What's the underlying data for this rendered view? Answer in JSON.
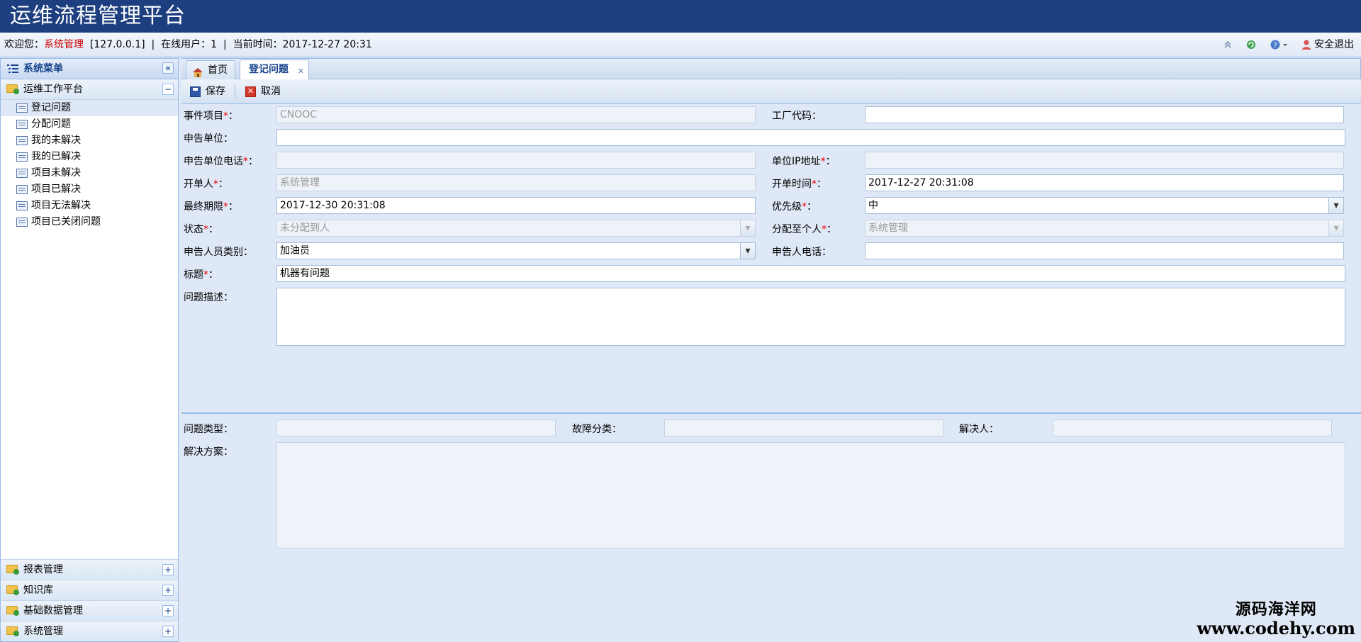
{
  "app": {
    "title": "运维流程管理平台"
  },
  "status": {
    "welcome_label": "欢迎您：",
    "user_name": "系统管理",
    "ip": "[127.0.0.1]",
    "online_label": "在线用户：1",
    "time_label": "当前时间：2017-12-27 20:31",
    "logout_label": "安全退出"
  },
  "sidebar": {
    "header": "系统菜单",
    "group_main": "运维工作平台",
    "items": [
      "登记问题",
      "分配问题",
      "我的未解决",
      "我的已解决",
      "项目未解决",
      "项目已解决",
      "项目无法解决",
      "项目已关闭问题"
    ],
    "bottom_groups": [
      "报表管理",
      "知识库",
      "基础数据管理",
      "系统管理"
    ]
  },
  "tabs": {
    "home": "首页",
    "active": "登记问题"
  },
  "toolbar": {
    "save": "保存",
    "cancel": "取消"
  },
  "form": {
    "event_project": {
      "label": "事件项目",
      "value": "CNOOC"
    },
    "factory_code": {
      "label": "工厂代码：",
      "value": ""
    },
    "report_unit": {
      "label": "申告单位：",
      "value": ""
    },
    "report_unit_phone": {
      "label": "申告单位电话",
      "value": ""
    },
    "unit_ip": {
      "label": "单位IP地址",
      "value": ""
    },
    "creator": {
      "label": "开单人",
      "value": "系统管理"
    },
    "create_time": {
      "label": "开单时间",
      "value": "2017-12-27 20:31:08"
    },
    "deadline": {
      "label": "最终期限",
      "value": "2017-12-30 20:31:08"
    },
    "priority": {
      "label": "优先级",
      "value": "中"
    },
    "state": {
      "label": "状态",
      "value": "未分配到人"
    },
    "assign_to": {
      "label": "分配至个人",
      "value": "系统管理"
    },
    "reporter_type": {
      "label": "申告人员类别：",
      "value": "加油员"
    },
    "reporter_phone": {
      "label": "申告人电话：",
      "value": ""
    },
    "subject": {
      "label": "标题",
      "value": "机器有问题"
    },
    "description": {
      "label": "问题描述：",
      "value": ""
    },
    "issue_type": {
      "label": "问题类型：",
      "value": ""
    },
    "fault_class": {
      "label": "故障分类：",
      "value": ""
    },
    "resolver": {
      "label": "解决人：",
      "value": ""
    },
    "solution": {
      "label": "解决方案：",
      "value": ""
    }
  },
  "watermark": {
    "line1": "源码海洋网",
    "line2": "www.codehy.com"
  }
}
